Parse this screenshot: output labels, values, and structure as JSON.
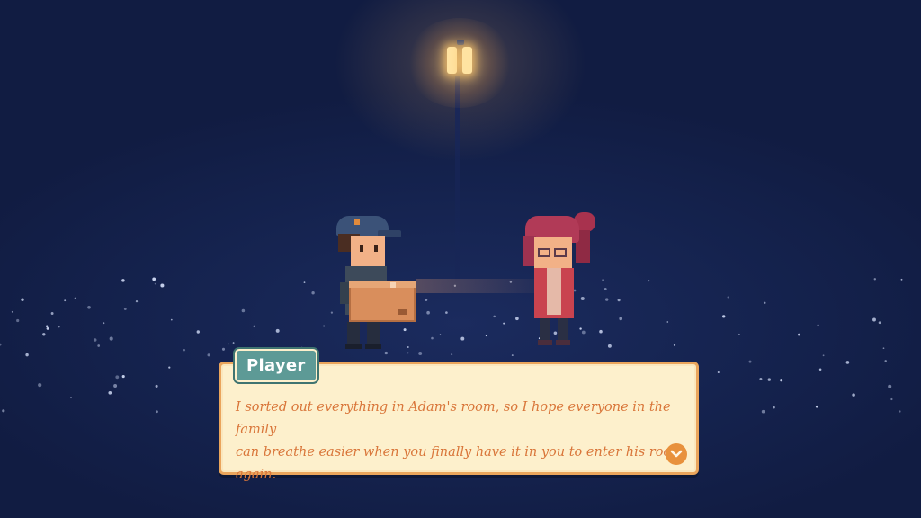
{
  "scene": {
    "name": "night-street-scene",
    "colors": {
      "sky": "#13204a",
      "lamp_light": "#ffe3a1"
    }
  },
  "dialog": {
    "speaker": "Player",
    "line1": "I sorted out everything in Adam's room, so I hope everyone in the family",
    "line2": "can breathe easier when you finally have it in you to enter his room again.",
    "next_icon": "chevron-down-icon",
    "colors": {
      "box_bg": "#fdf0cc",
      "border": "#eaa55c",
      "text": "#d9763a",
      "name_tag": "#5d9a96",
      "button": "#e8913c"
    }
  }
}
